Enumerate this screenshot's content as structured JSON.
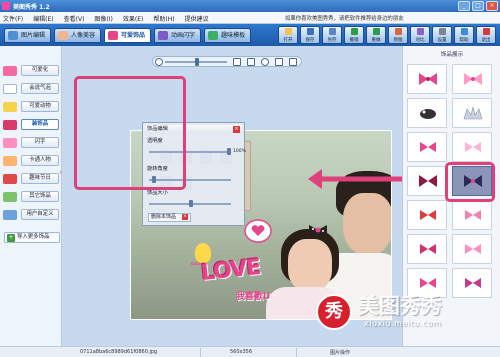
{
  "window": {
    "title": "美图秀秀 1.2",
    "min": "_",
    "max": "□",
    "close": "×"
  },
  "menubar": {
    "items": [
      "文件(F)",
      "编辑(E)",
      "查看(V)",
      "图像(I)",
      "效果(E)",
      "帮助(H)",
      "提供建议"
    ],
    "notice": "如果你喜欢美图秀秀，请把软件推荐给身边的朋友"
  },
  "tabs": [
    {
      "label": "图片编辑",
      "active": false,
      "icon": "photo-icon"
    },
    {
      "label": "人像美容",
      "active": false,
      "icon": "face-icon"
    },
    {
      "label": "可爱饰品",
      "active": true,
      "icon": "bow-icon"
    },
    {
      "label": "动画闪字",
      "active": false,
      "icon": "film-icon"
    },
    {
      "label": "趣味模板",
      "active": false,
      "icon": "template-icon"
    }
  ],
  "toolbar": [
    "打开",
    "保存",
    "另存",
    "撤销",
    "重做",
    "原图",
    "对比",
    "设置",
    "帮助",
    "退出"
  ],
  "sidebar": {
    "items": [
      {
        "label": "可爱化",
        "selected": false
      },
      {
        "label": "会说气泡",
        "selected": false
      },
      {
        "label": "可爱动物",
        "selected": false
      },
      {
        "label": "装饰品",
        "selected": true
      },
      {
        "label": "闪字",
        "selected": false
      },
      {
        "label": "卡通人物",
        "selected": false
      },
      {
        "label": "趣味节日",
        "selected": false,
        "badge": "HOT"
      },
      {
        "label": "其它饰品",
        "selected": false
      },
      {
        "label": "用户自定义",
        "selected": false
      }
    ],
    "import_label": "导入更多饰品"
  },
  "panel": {
    "title": "饰品编辑",
    "close": "×",
    "opacity_label": "透明度",
    "opacity_value": "100%",
    "opacity_level": 1.0,
    "rotate_label": "旋转角度",
    "rotate_level": 0.05,
    "size_label": "饰品大小",
    "size_level": 0.5,
    "delete_label": "删除本饰品",
    "delete_x": "×"
  },
  "photo": {
    "love_text": "LOVE",
    "caption_text": "我喜歡U",
    "bunny_tag": "cute"
  },
  "rightpanel": {
    "title": "饰品展示"
  },
  "status": {
    "filename": "0711a8ba6c8989d61f0860.jpg",
    "dimensions": "560x356",
    "action": "图片操作"
  },
  "watermark": {
    "brand": "美图秀秀",
    "logo_char": "秀",
    "url": "xiuxiu.meitu.com"
  },
  "colors": {
    "highlight": "#e0407a",
    "accent": "#1e5aa8",
    "love_pink": "#e6458c"
  }
}
